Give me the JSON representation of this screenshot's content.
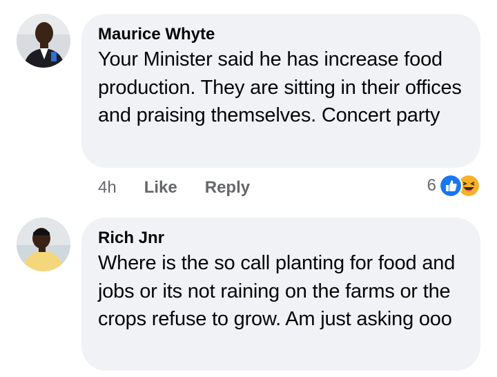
{
  "comments": [
    {
      "author": "Maurice Whyte",
      "text": "Your Minister said he has increase food production. They are sitting in their offices and praising themselves. Concert party",
      "time": "4h",
      "like_label": "Like",
      "reply_label": "Reply",
      "reaction_count": "6",
      "reactions": [
        "like-icon",
        "haha-icon"
      ]
    },
    {
      "author": "Rich Jnr",
      "text": "Where is the so call planting for food and jobs or its not raining on the farms or the crops refuse to grow. Am just asking ooo"
    }
  ],
  "colors": {
    "bubble": "#f0f2f5",
    "like_blue": "#1877f2",
    "haha_yellow": "#f7b125",
    "meta_gray": "#65676b"
  }
}
